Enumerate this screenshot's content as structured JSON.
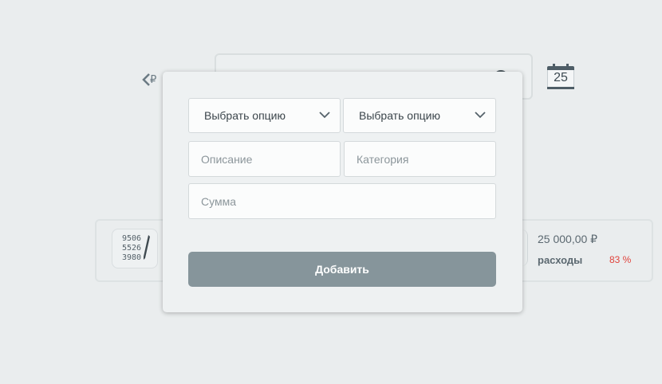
{
  "header": {
    "back_currency": "₽",
    "calendar_day": "25"
  },
  "stats": {
    "counter_digits": [
      "9506",
      "5526",
      "3980"
    ],
    "amount": "25 000,00 ₽",
    "expenses_label": "расходы",
    "percent": "83 %",
    "percent_color": "#e0433c"
  },
  "modal": {
    "select1": "Выбрать опцию",
    "select2": "Выбрать опцию",
    "description_placeholder": "Описание",
    "category_placeholder": "Категория",
    "sum_placeholder": "Сумма",
    "add_button": "Добавить",
    "button_color": "#86959b"
  }
}
